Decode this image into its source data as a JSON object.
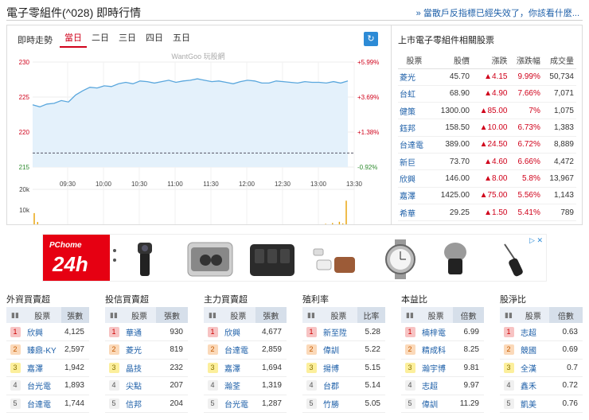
{
  "page": {
    "title": "電子零組件(^028) 即時行情",
    "notice_link": "» 當散戶反指標已經失效了，你該看什麼..."
  },
  "chart_panel": {
    "heading": "即時走勢",
    "tabs": [
      "當日",
      "二日",
      "三日",
      "四日",
      "五日"
    ],
    "active_tab": "當日",
    "watermark": "WantGoo 玩股網",
    "refresh_icon": "refresh-icon"
  },
  "chart_data": {
    "type": "line",
    "x_ticks": [
      "09:30",
      "10:00",
      "10:30",
      "11:00",
      "11:30",
      "12:00",
      "12:30",
      "13:00",
      "13:30"
    ],
    "y_ticks_left": [
      "230",
      "225",
      "220",
      "215"
    ],
    "y_ticks_right": [
      "+5.99%",
      "+3.69%",
      "+1.38%",
      "-0.92%"
    ],
    "ylim": [
      215,
      230
    ],
    "reference_value": 217,
    "line_color": "#5aa7dd",
    "fill_color": "#e4f1fb",
    "series": [
      {
        "values": [
          223.9,
          223.6,
          224.0,
          224.1,
          224.5,
          224.3,
          225.3,
          225.9,
          226.4,
          226.3,
          226.6,
          226.5,
          226.9,
          227.1,
          226.9,
          227.3,
          227.2,
          227.0,
          227.2,
          227.4,
          227.1,
          227.3,
          227.4,
          227.6,
          227.4,
          227.2,
          227.3,
          227.1,
          226.9,
          227.2,
          227.4,
          227.3,
          227.0,
          227.0,
          227.3,
          227.2,
          227.1,
          227.0,
          227.2,
          227.1,
          227.1,
          227.0,
          227.2,
          227.0,
          227.3
        ]
      }
    ],
    "volume_ticks": [
      "20k",
      "10k",
      "0"
    ],
    "volume_ylim": [
      0,
      20000
    ],
    "volume_color": "#e8a000",
    "volume_values": [
      8500,
      4200,
      2500,
      1800,
      1200,
      1500,
      1100,
      900,
      1300,
      1000,
      800,
      700,
      900,
      600,
      800,
      700,
      600,
      700,
      500,
      600,
      700,
      500,
      600,
      500,
      700,
      600,
      500,
      600,
      500,
      400,
      600,
      500,
      400,
      500,
      600,
      500,
      400,
      600,
      500,
      400,
      500,
      600,
      500,
      700,
      600,
      500,
      600,
      500,
      700,
      800,
      600,
      700,
      600,
      800,
      900,
      700,
      800,
      1000,
      900,
      800,
      1100,
      1000,
      1200,
      1300,
      1100,
      1400,
      1200,
      1500,
      1300,
      1600,
      1400,
      1800,
      1500,
      1900,
      1600,
      2000,
      1700,
      2200,
      1800,
      2400,
      2000,
      2600,
      2100,
      3000,
      2400,
      3300,
      2600,
      3700,
      3000,
      4300,
      3500,
      14500
    ]
  },
  "related": {
    "title": "上市電子零組件相關股票",
    "columns": [
      "股票",
      "股價",
      "漲跌",
      "漲跌幅",
      "成交量"
    ],
    "rows": [
      {
        "name": "菱光",
        "price": "45.70",
        "change": "▲4.15",
        "pct": "9.99%",
        "volume": "50,734"
      },
      {
        "name": "台虹",
        "price": "68.90",
        "change": "▲4.90",
        "pct": "7.66%",
        "volume": "7,071"
      },
      {
        "name": "健策",
        "price": "1300.00",
        "change": "▲85.00",
        "pct": "7%",
        "volume": "1,075"
      },
      {
        "name": "鈺邦",
        "price": "158.50",
        "change": "▲10.00",
        "pct": "6.73%",
        "volume": "1,383"
      },
      {
        "name": "台達電",
        "price": "389.00",
        "change": "▲24.50",
        "pct": "6.72%",
        "volume": "8,889"
      },
      {
        "name": "新巨",
        "price": "73.70",
        "change": "▲4.60",
        "pct": "6.66%",
        "volume": "4,472"
      },
      {
        "name": "欣興",
        "price": "146.00",
        "change": "▲8.00",
        "pct": "5.8%",
        "volume": "13,967"
      },
      {
        "name": "嘉澤",
        "price": "1425.00",
        "change": "▲75.00",
        "pct": "5.56%",
        "volume": "1,143"
      },
      {
        "name": "希華",
        "price": "29.25",
        "change": "▲1.50",
        "pct": "5.41%",
        "volume": "789"
      }
    ]
  },
  "ad": {
    "brand": "PChome",
    "tagline": "24h",
    "adchoice": "▷ ✕",
    "products": [
      "pocket-camera-icon",
      "earbuds-case-icon",
      "wireless-mic-kit-icon",
      "usb-mic-icon",
      "watch-icon",
      "clip-mic-icon",
      "handheld-mic-icon"
    ]
  },
  "rankings": [
    {
      "title": "外資買賣超",
      "col_stock": "股票",
      "col_value": "張數",
      "rows": [
        [
          "1",
          "欣興",
          "4,125"
        ],
        [
          "2",
          "臻鼎-KY",
          "2,597"
        ],
        [
          "3",
          "嘉澤",
          "1,942"
        ],
        [
          "4",
          "台光電",
          "1,893"
        ],
        [
          "5",
          "台達電",
          "1,744"
        ]
      ]
    },
    {
      "title": "投信買賣超",
      "col_stock": "股票",
      "col_value": "張數",
      "rows": [
        [
          "1",
          "華通",
          "930"
        ],
        [
          "2",
          "菱光",
          "819"
        ],
        [
          "3",
          "晶技",
          "232"
        ],
        [
          "4",
          "尖點",
          "207"
        ],
        [
          "5",
          "信邦",
          "204"
        ]
      ]
    },
    {
      "title": "主力買賣超",
      "col_stock": "股票",
      "col_value": "張數",
      "rows": [
        [
          "1",
          "欣興",
          "4,677"
        ],
        [
          "2",
          "台達電",
          "2,859"
        ],
        [
          "3",
          "嘉澤",
          "1,694"
        ],
        [
          "4",
          "瀚荃",
          "1,319"
        ],
        [
          "5",
          "台光電",
          "1,287"
        ]
      ]
    },
    {
      "title": "殖利率",
      "col_stock": "股票",
      "col_value": "比率",
      "rows": [
        [
          "1",
          "新至陞",
          "5.28"
        ],
        [
          "2",
          "偉訓",
          "5.22"
        ],
        [
          "3",
          "揚博",
          "5.15"
        ],
        [
          "4",
          "台郡",
          "5.14"
        ],
        [
          "5",
          "竹勝",
          "5.05"
        ]
      ]
    },
    {
      "title": "本益比",
      "col_stock": "股票",
      "col_value": "倍數",
      "rows": [
        [
          "1",
          "楠梓電",
          "6.99"
        ],
        [
          "2",
          "精成科",
          "8.25"
        ],
        [
          "3",
          "瀚宇博",
          "9.81"
        ],
        [
          "4",
          "志超",
          "9.97"
        ],
        [
          "5",
          "偉訓",
          "11.29"
        ]
      ]
    },
    {
      "title": "股淨比",
      "col_stock": "股票",
      "col_value": "倍數",
      "rows": [
        [
          "1",
          "志超",
          "0.63"
        ],
        [
          "2",
          "競國",
          "0.69"
        ],
        [
          "3",
          "全漢",
          "0.7"
        ],
        [
          "4",
          "鑫禾",
          "0.72"
        ],
        [
          "5",
          "凱美",
          "0.76"
        ]
      ]
    }
  ]
}
